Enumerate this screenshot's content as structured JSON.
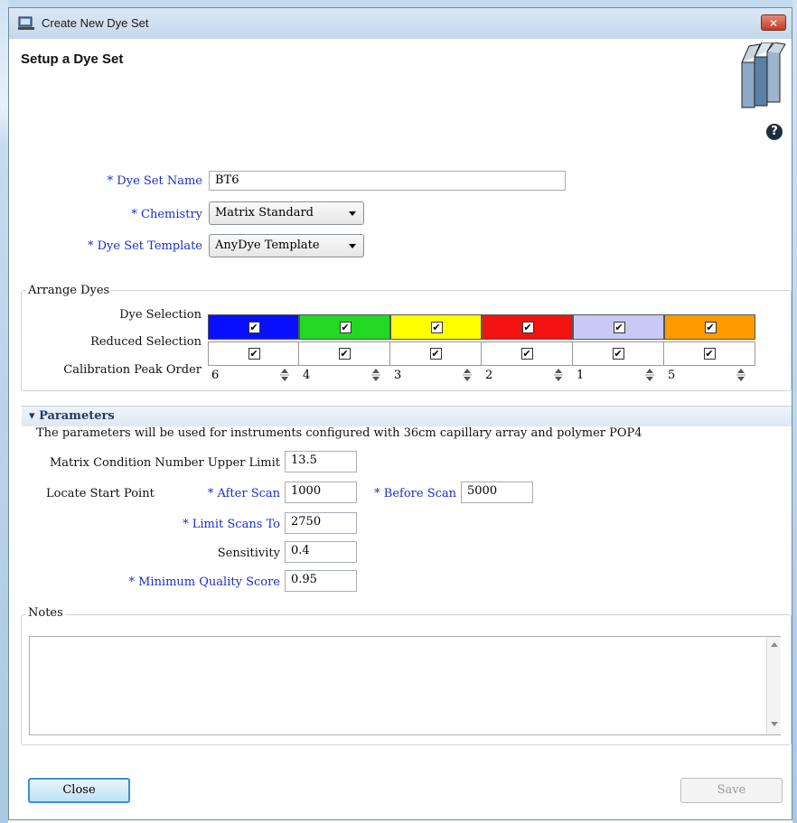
{
  "window": {
    "title": "Create New Dye Set",
    "close_glyph": "✕"
  },
  "page_title": "Setup a Dye Set",
  "help_glyph": "?",
  "form": {
    "required_mark": "*",
    "dye_set_name_label": "Dye Set Name",
    "dye_set_name_value": "BT6",
    "chemistry_label": "Chemistry",
    "chemistry_value": "Matrix Standard",
    "template_label": "Dye Set Template",
    "template_value": "AnyDye Template"
  },
  "arrange_dyes": {
    "title": "Arrange Dyes",
    "dye_selection_label": "Dye Selection",
    "reduced_selection_label": "Reduced Selection",
    "calibration_label": "Calibration Peak Order",
    "dyes": [
      {
        "color": "#0a10ff",
        "selected": true,
        "reduced": true,
        "order": "6"
      },
      {
        "color": "#22d822",
        "selected": true,
        "reduced": true,
        "order": "4"
      },
      {
        "color": "#ffff00",
        "selected": true,
        "reduced": true,
        "order": "3"
      },
      {
        "color": "#f21212",
        "selected": true,
        "reduced": true,
        "order": "2"
      },
      {
        "color": "#c9c9f5",
        "selected": true,
        "reduced": true,
        "order": "1"
      },
      {
        "color": "#ff9a00",
        "selected": true,
        "reduced": true,
        "order": "5"
      }
    ],
    "check_glyph": "✔"
  },
  "parameters": {
    "title": "Parameters",
    "description": "The parameters will be used for instruments configured with 36cm capillary array and polymer POP4",
    "matrix_label": "Matrix Condition Number Upper Limit",
    "matrix_value": "13.5",
    "locate_label": "Locate Start Point",
    "after_scan_label": "After Scan",
    "after_scan_value": "1000",
    "before_scan_label": "Before Scan",
    "before_scan_value": "5000",
    "limit_scans_label": "Limit Scans To",
    "limit_scans_value": "2750",
    "sensitivity_label": "Sensitivity",
    "sensitivity_value": "0.4",
    "min_quality_label": "Minimum Quality Score",
    "min_quality_value": "0.95"
  },
  "notes": {
    "title": "Notes",
    "value": ""
  },
  "buttons": {
    "close": "Close",
    "save": "Save"
  }
}
